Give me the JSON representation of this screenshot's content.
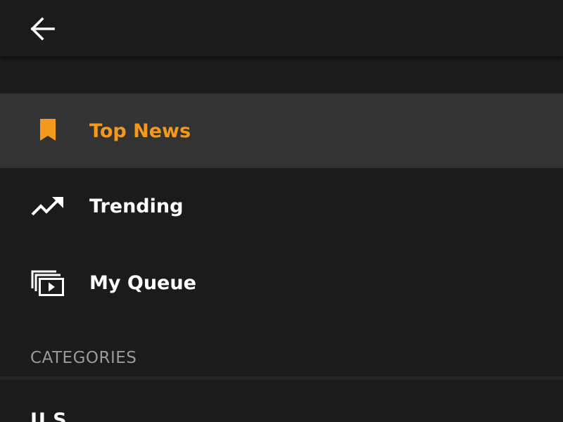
{
  "toolbar": {
    "back_icon": "arrow-back-icon"
  },
  "nav": {
    "items": [
      {
        "label": "Top News",
        "icon": "bookmark-icon",
        "selected": true
      },
      {
        "label": "Trending",
        "icon": "trending-up-icon",
        "selected": false
      },
      {
        "label": "My Queue",
        "icon": "video-library-icon",
        "selected": false
      }
    ]
  },
  "categories": {
    "header": "CATEGORIES",
    "items": [
      {
        "label": "U.S."
      }
    ]
  },
  "colors": {
    "background": "#1b1b1b",
    "selected_background": "#333333",
    "accent": "#f39a1e",
    "text": "#ffffff",
    "muted_text": "#9a9a9a"
  }
}
